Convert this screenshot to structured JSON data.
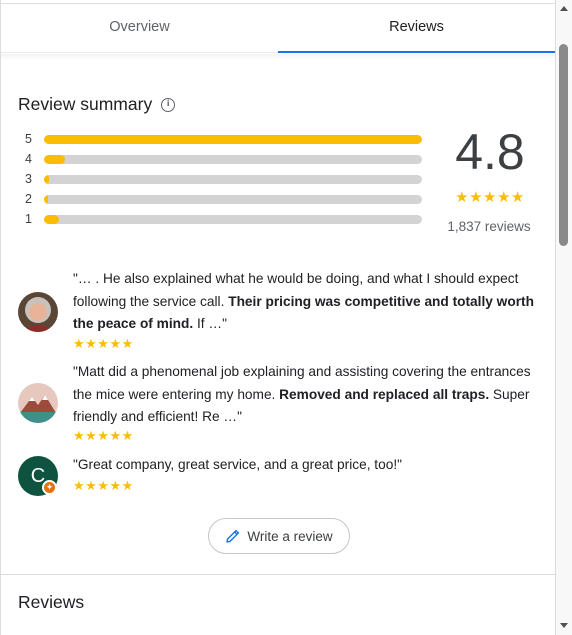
{
  "tabs": [
    {
      "label": "Overview",
      "active": false
    },
    {
      "label": "Reviews",
      "active": true
    }
  ],
  "summary": {
    "title": "Review summary",
    "info_icon": "info-icon",
    "bars": [
      {
        "stars": "5",
        "fraction": 1.0
      },
      {
        "stars": "4",
        "fraction": 0.055
      },
      {
        "stars": "3",
        "fraction": 0.012
      },
      {
        "stars": "2",
        "fraction": 0.008
      },
      {
        "stars": "1",
        "fraction": 0.04
      }
    ],
    "rating": "4.8",
    "stars": "★★★★★",
    "review_count": "1,837 reviews",
    "accent_color": "#fbbc04",
    "track_color": "#d3d3d3"
  },
  "snippets": [
    {
      "avatar": "user-photo-avatar",
      "text_before": "\"… . He also explained what he would be doing, and what I should expect following the service call. ",
      "text_bold": "Their pricing was competitive and totally worth the peace of mind.",
      "text_after": " If …\"",
      "stars": "★★★★★"
    },
    {
      "avatar": "mountain-avatar",
      "text_before": "\"Matt did a phenomenal job explaining and assisting covering the entrances the mice were entering my home. ",
      "text_bold": "Removed and replaced all traps.",
      "text_after": " Super friendly and efficient! Re …\"",
      "stars": "★★★★★"
    },
    {
      "avatar": "letter-avatar",
      "avatar_letter": "C",
      "avatar_color": "#0d5340",
      "text_before": "\"Great company, great service, and a great price, too!\"",
      "text_bold": "",
      "text_after": "",
      "stars": "★★★★★"
    }
  ],
  "write_review": {
    "label": "Write a review",
    "icon": "pencil-icon"
  },
  "reviews_heading": "Reviews"
}
